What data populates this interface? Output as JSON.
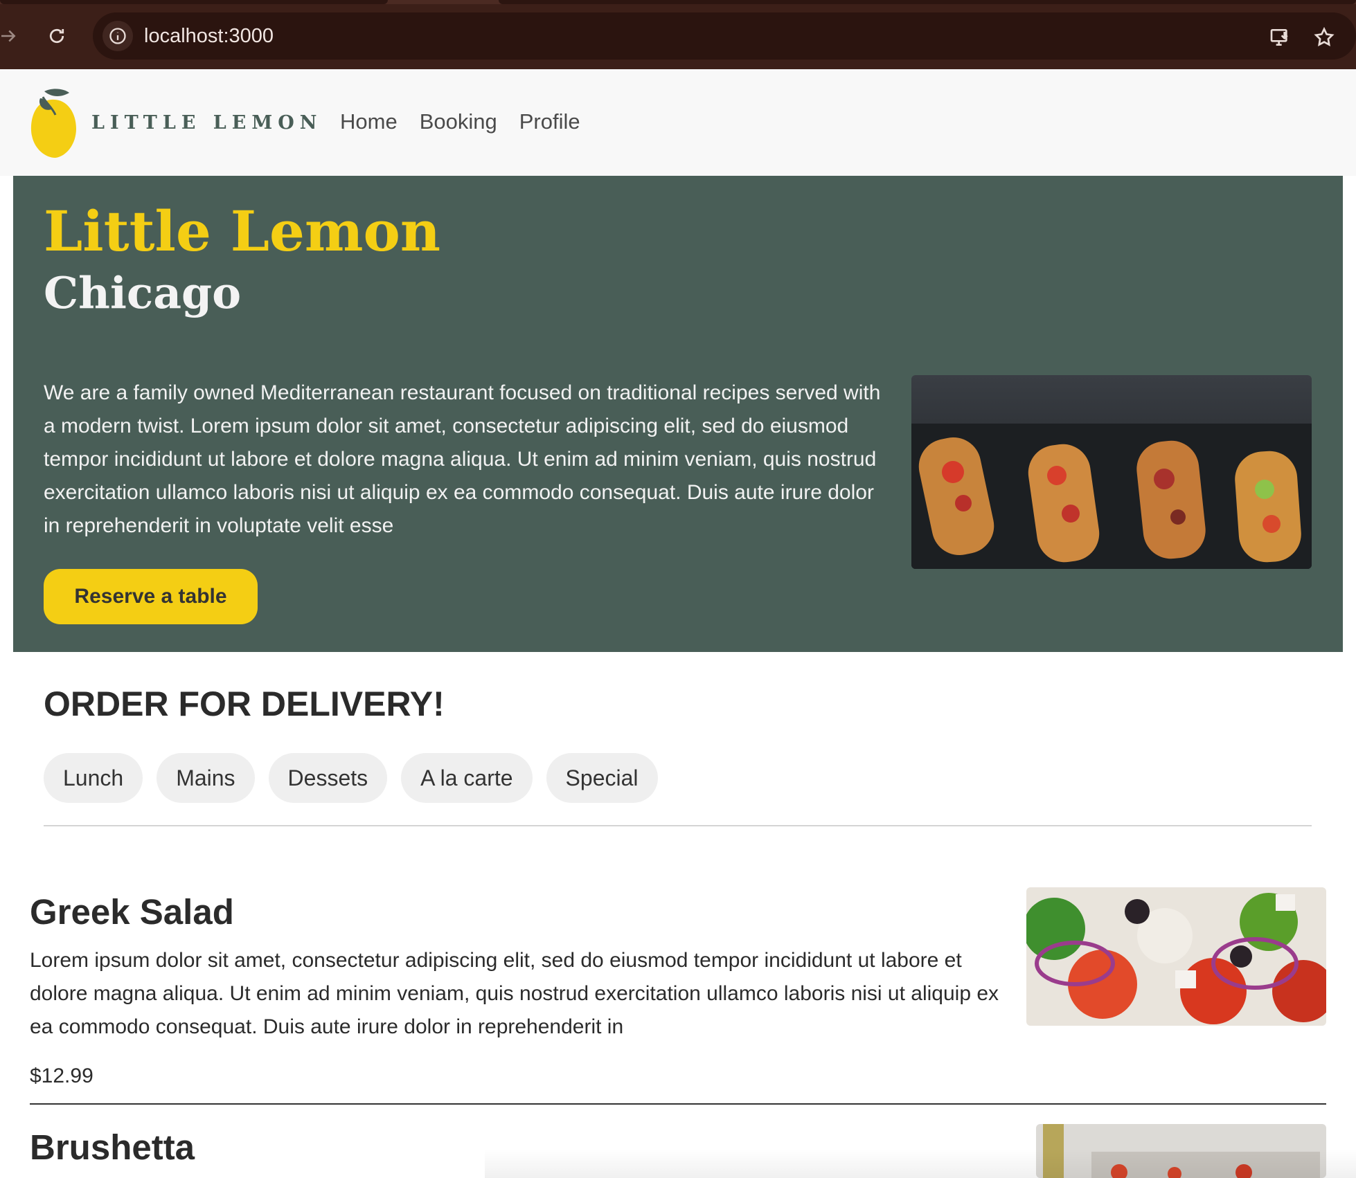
{
  "browser": {
    "url": "localhost:3000"
  },
  "header": {
    "logo_text": "LITTLE LEMON",
    "nav": [
      "Home",
      "Booking",
      "Profile"
    ]
  },
  "hero": {
    "title": "Little Lemon",
    "subtitle": "Chicago",
    "description": "We are a family owned Mediterranean restaurant focused on traditional recipes served with a modern twist. Lorem ipsum dolor sit amet, consectetur adipiscing elit, sed do eiusmod tempor incididunt ut labore et dolore magna aliqua. Ut enim ad minim veniam, quis nostrud exercitation ullamco laboris nisi ut aliquip ex ea commodo consequat. Duis aute irure dolor in reprehenderit in voluptate velit esse",
    "button": "Reserve a table"
  },
  "order": {
    "heading": "ORDER FOR DELIVERY!",
    "filters": [
      "Lunch",
      "Mains",
      "Dessets",
      "A la carte",
      "Special"
    ]
  },
  "menu_items": [
    {
      "name": "Greek Salad",
      "description": "Lorem ipsum dolor sit amet, consectetur adipiscing elit, sed do eiusmod tempor incididunt ut labore et dolore magna aliqua. Ut enim ad minim veniam, quis nostrud exercitation ullamco laboris nisi ut aliquip ex ea commodo consequat. Duis aute irure dolor in reprehenderit in",
      "price": "$12.99"
    },
    {
      "name": "Brushetta"
    }
  ],
  "colors": {
    "brand_green": "#495e57",
    "brand_yellow": "#f4ce14",
    "browser_chrome": "#3c1f18"
  },
  "icons": [
    "back-icon",
    "reload-icon",
    "info-icon",
    "install-icon",
    "bookmark-star-icon",
    "lemon-logo-icon"
  ]
}
